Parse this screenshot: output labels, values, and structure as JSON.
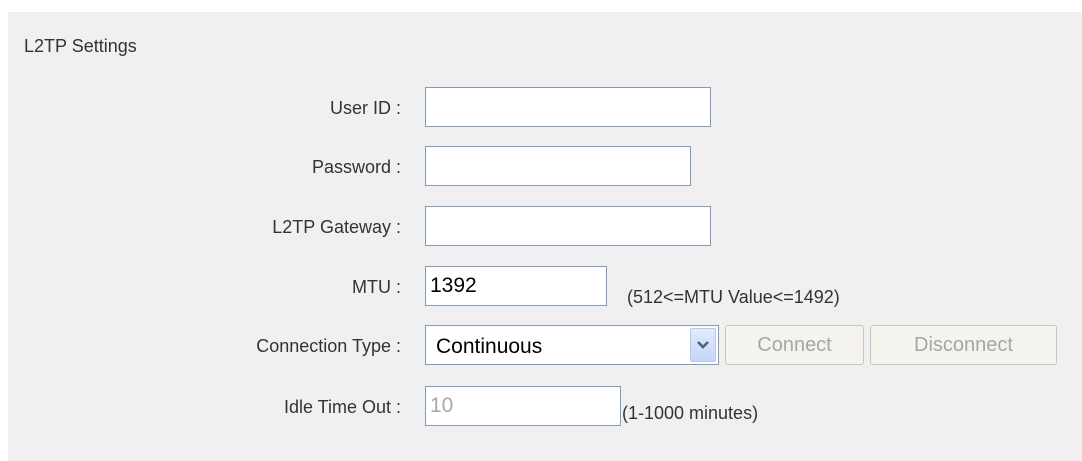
{
  "section": {
    "title": "L2TP Settings"
  },
  "fields": {
    "user_id": {
      "label": "User ID :",
      "value": ""
    },
    "password": {
      "label": "Password :",
      "value": ""
    },
    "gateway": {
      "label": "L2TP Gateway :",
      "value": ""
    },
    "mtu": {
      "label": "MTU :",
      "value": "1392",
      "hint": "(512<=MTU Value<=1492)"
    },
    "connection_type": {
      "label": "Connection Type :",
      "selected": "Continuous"
    },
    "idle_timeout": {
      "label": "Idle Time Out :",
      "value": "10",
      "hint": "(1-1000 minutes)"
    }
  },
  "buttons": {
    "connect": "Connect",
    "disconnect": "Disconnect"
  },
  "icons": {
    "dropdown": "chevron-down-icon"
  },
  "colors": {
    "panel_bg": "#f0f0f0",
    "input_border": "#7f9db9",
    "disabled_text": "#a6a6a6",
    "dropdown_arrow": "#4d6185"
  }
}
